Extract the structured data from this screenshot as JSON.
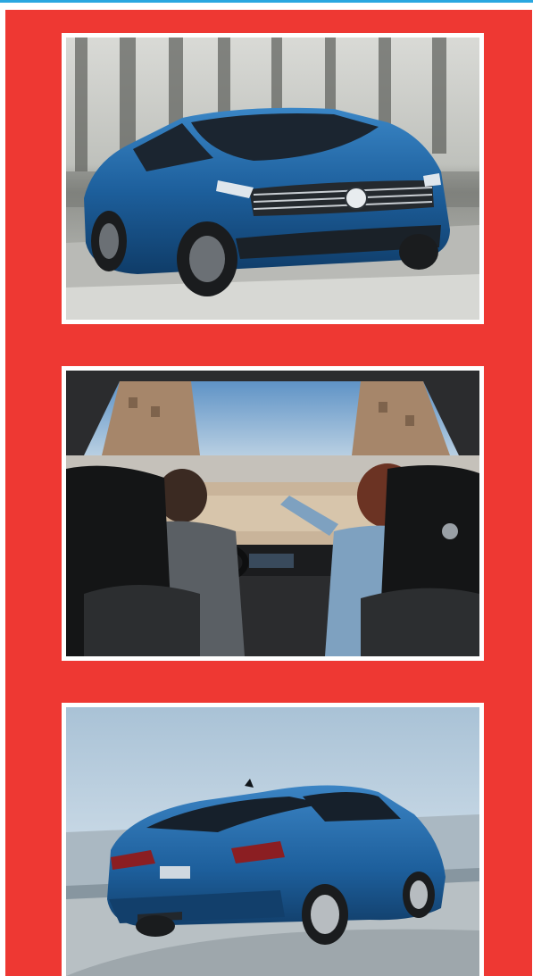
{
  "colors": {
    "accent_rule": "#2aa7e0",
    "panel_background": "#ee3833",
    "photo_border": "#ffffff",
    "car_body": "#1d5f9c"
  },
  "photos": [
    {
      "subject": "car-front-photo"
    },
    {
      "subject": "car-interior-photo"
    },
    {
      "subject": "car-rear-photo"
    }
  ]
}
